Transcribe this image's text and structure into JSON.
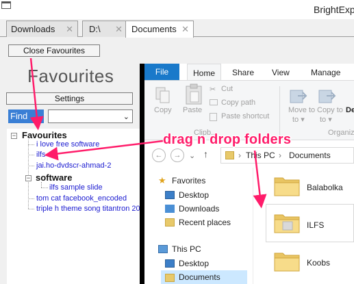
{
  "app": {
    "title": "BrightExp"
  },
  "tabs": [
    {
      "label": "Downloads",
      "close": "✕"
    },
    {
      "label": "D:\\",
      "close": "✕"
    },
    {
      "label": "Documents",
      "close": "✕"
    }
  ],
  "left": {
    "close_favourites_label": "Close Favourites",
    "heading": "Favourites",
    "settings_label": "Settings",
    "find_label": "Find",
    "dropdown_value": ""
  },
  "tree": {
    "root": "Favourites",
    "items": [
      "i love free software",
      "ilfs",
      "jai.ho-dvdscr-ahmad-2"
    ],
    "group": "software",
    "group_items": [
      "ilfs sample slide"
    ],
    "after_items": [
      "tom cat facebook_encoded",
      "triple h theme song titantron 20"
    ]
  },
  "explorer": {
    "ribbon_tabs": [
      "File",
      "Home",
      "Share",
      "View",
      "Manage"
    ],
    "copy_label": "Copy",
    "paste_label": "Paste",
    "cut_label": "Cut",
    "copy_path_label": "Copy path",
    "paste_shortcut_label": "Paste shortcut",
    "move_to_label": "Move to",
    "copy_to_label": "Copy to",
    "clipboard_group": "Clipb...",
    "organize_group": "Organiz",
    "de_label": "De",
    "address": [
      "This PC",
      "Documents"
    ],
    "nav_items": [
      {
        "label": "Favorites",
        "icon": "star-icon"
      },
      {
        "label": "Desktop",
        "icon": "desktop-icon"
      },
      {
        "label": "Downloads",
        "icon": "downloads-icon"
      },
      {
        "label": "Recent places",
        "icon": "recent-places-icon"
      },
      {
        "label": "This PC",
        "icon": "computer-icon"
      },
      {
        "label": "Desktop",
        "icon": "desktop-icon"
      },
      {
        "label": "Documents",
        "icon": "documents-icon"
      }
    ],
    "folders": [
      "Balabolka",
      "ILFS",
      "Koobs"
    ]
  },
  "annotation": {
    "text": "drag n drop folders",
    "color": "#ff1c6a"
  },
  "colors": {
    "accent": "#1979ca",
    "find_button": "#3a7fd5",
    "link": "#1a1ad0"
  }
}
